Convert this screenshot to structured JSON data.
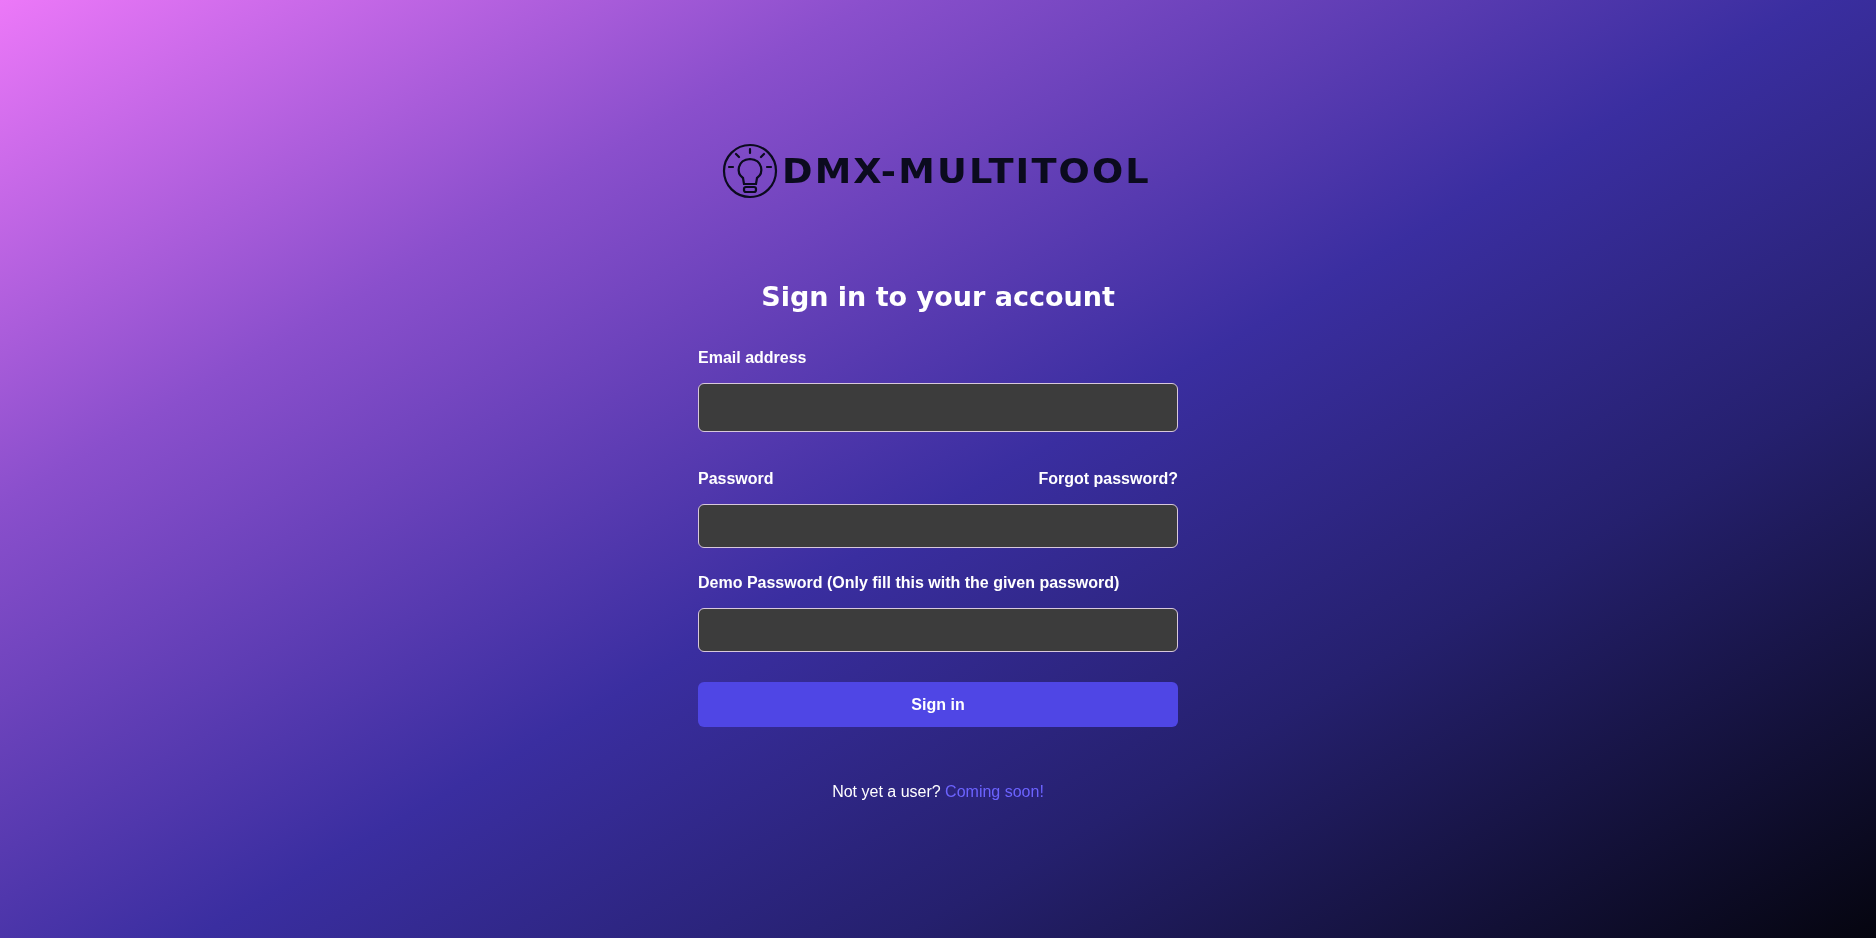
{
  "logo": {
    "text": "DMX-MULTITOOL"
  },
  "heading": "Sign in to your account",
  "fields": [
    {
      "label": "Email address"
    },
    {
      "label": "Password",
      "link": "Forgot password?"
    },
    {
      "label": "Demo Password (Only fill this with the given password)"
    }
  ],
  "submit": "Sign in",
  "footer": {
    "text": "Not yet a user?",
    "link": "Coming soon!"
  }
}
